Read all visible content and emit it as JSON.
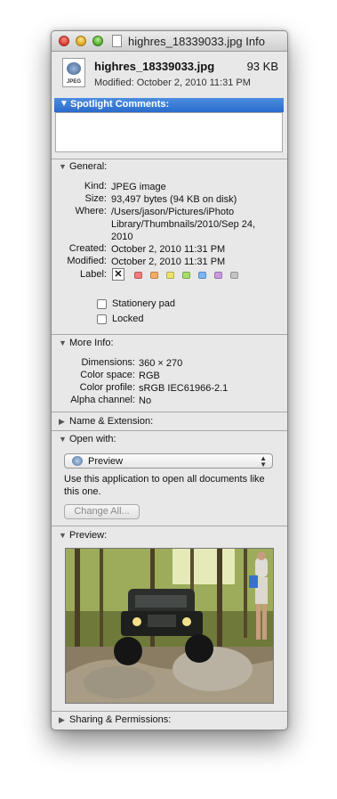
{
  "window": {
    "title": "highres_18339033.jpg Info"
  },
  "header": {
    "file_name": "highres_18339033.jpg",
    "file_size": "93 KB",
    "modified": "Modified: October 2, 2010 11:31 PM",
    "icon_tag": "JPEG"
  },
  "spotlight": {
    "heading": "Spotlight Comments:",
    "comments": ""
  },
  "general": {
    "heading": "General:",
    "kind_label": "Kind:",
    "kind": "JPEG image",
    "size_label": "Size:",
    "size": "93,497 bytes (94 KB on disk)",
    "where_label": "Where:",
    "where": "/Users/jason/Pictures/iPhoto Library/Thumbnails/2010/Sep 24, 2010",
    "created_label": "Created:",
    "created": "October 2, 2010 11:31 PM",
    "modified_label": "Modified:",
    "modified": "October 2, 2010 11:31 PM",
    "label_label": "Label:",
    "label_colors": [
      "#f27a7a",
      "#f5ad61",
      "#eee36a",
      "#a6dd6b",
      "#7bb6f2",
      "#c99ae0",
      "#c4c4c4"
    ],
    "stationery": "Stationery pad",
    "locked": "Locked"
  },
  "more_info": {
    "heading": "More Info:",
    "dimensions_label": "Dimensions:",
    "dimensions": "360 × 270",
    "color_space_label": "Color space:",
    "color_space": "RGB",
    "color_profile_label": "Color profile:",
    "color_profile": "sRGB IEC61966-2.1",
    "alpha_label": "Alpha channel:",
    "alpha": "No"
  },
  "name_ext": {
    "heading": "Name & Extension:"
  },
  "open_with": {
    "heading": "Open with:",
    "app": "Preview",
    "hint": "Use this application to open all documents like this one.",
    "change_all": "Change All..."
  },
  "preview": {
    "heading": "Preview:"
  },
  "sharing": {
    "heading": "Sharing & Permissions:"
  }
}
